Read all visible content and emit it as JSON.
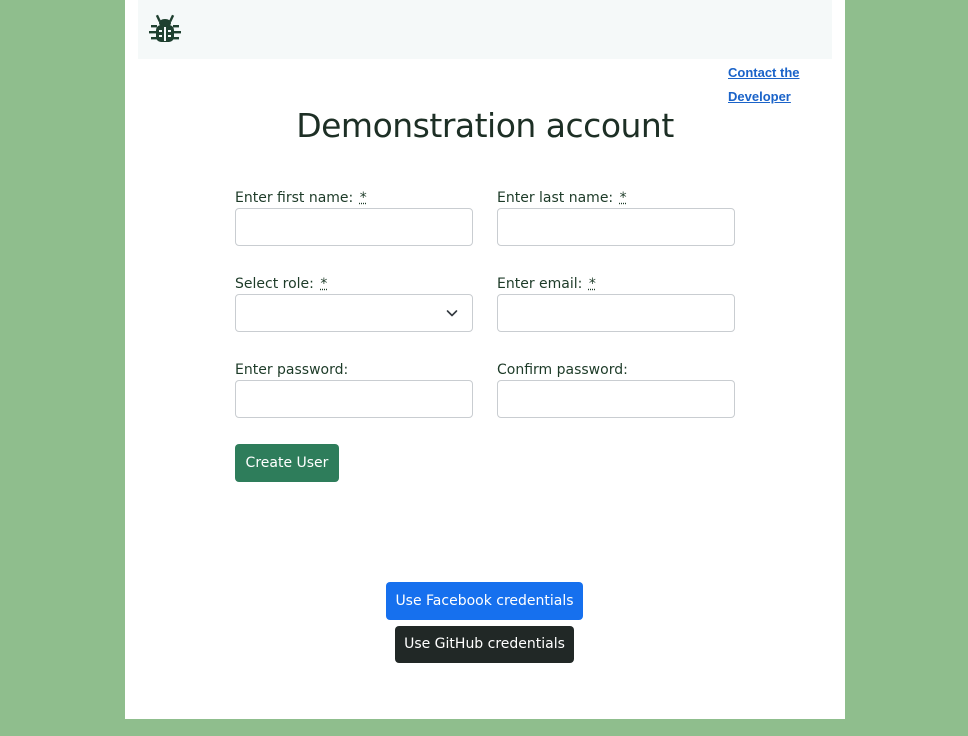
{
  "header": {
    "logo_icon": "bug-icon",
    "contact_link": "Contact the Developer"
  },
  "form": {
    "title": "Demonstration account",
    "required_marker": "*",
    "first_name_label": "Enter first name:",
    "last_name_label": "Enter last name:",
    "role_label": "Select role:",
    "role_value": "",
    "email_label": "Enter email:",
    "password_label": "Enter password:",
    "confirm_password_label": "Confirm password:",
    "first_name_value": "",
    "last_name_value": "",
    "email_value": "",
    "password_value": "",
    "confirm_password_value": "",
    "submit_label": "Create User"
  },
  "social": {
    "facebook_label": "Use Facebook credentials",
    "github_label": "Use GitHub credentials"
  },
  "colors": {
    "background": "#8fbe8d",
    "navbar": "#f5f9f9",
    "primary_green": "#2e7d5b",
    "facebook_blue": "#1670ee",
    "github_dark": "#212826",
    "link": "#1a63c9"
  }
}
